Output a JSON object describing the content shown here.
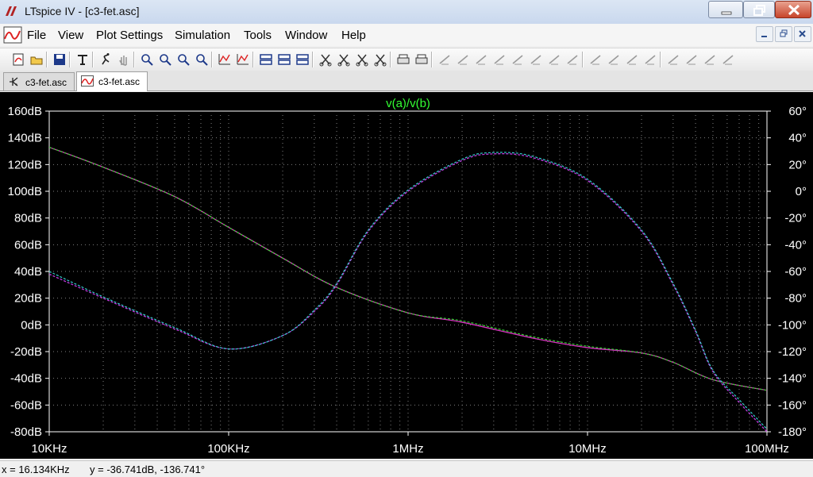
{
  "window": {
    "title": "LTspice IV - [c3-fet.asc]"
  },
  "menu": {
    "items": [
      "File",
      "View",
      "Plot Settings",
      "Simulation",
      "Tools",
      "Window",
      "Help"
    ]
  },
  "toolbar": {
    "icons": [
      "new-schematic-icon",
      "open-icon",
      "save-icon",
      "control-panel-icon",
      "run-icon",
      "halt-icon",
      "zoom-in-icon",
      "zoom-area-icon",
      "zoom-out-icon",
      "zoom-cancel-icon",
      "autorange-icon",
      "autorange-y-icon",
      "tile-horizontal-icon",
      "cascade-icon",
      "tile-vertical-icon",
      "cut-icon",
      "copy-icon",
      "paste-icon",
      "find-icon",
      "print-setup-icon",
      "print-icon",
      "wire-icon",
      "ground-icon",
      "label-icon",
      "resistor-icon",
      "capacitor-icon",
      "inductor-icon",
      "diode-icon",
      "component-icon",
      "move-icon",
      "drag-icon",
      "undo-icon",
      "redo-icon",
      "rotate-icon",
      "mirror-icon",
      "text-icon",
      "spice-directive-icon"
    ]
  },
  "tabs": [
    {
      "label": "c3-fet.asc",
      "icon": "schematic-icon",
      "active": false
    },
    {
      "label": "c3-fet.asc",
      "icon": "waveform-icon",
      "active": true
    }
  ],
  "status": {
    "x_readout": "x = 16.134KHz",
    "y_readout": "y = -36.741dB, -136.741°"
  },
  "colors": {
    "background": "#000000",
    "grid": "#7f7f7f",
    "trace_title": "#33ff33"
  },
  "chart_data": {
    "type": "line",
    "title": "v(a)/v(b)",
    "xscale": "log",
    "xlim": [
      10000,
      100000000
    ],
    "x_ticks": [
      {
        "value": 10000,
        "label": "10KHz"
      },
      {
        "value": 100000,
        "label": "100KHz"
      },
      {
        "value": 1000000,
        "label": "1MHz"
      },
      {
        "value": 10000000,
        "label": "10MHz"
      },
      {
        "value": 100000000,
        "label": "100MHz"
      }
    ],
    "ylim_left": [
      -80,
      160
    ],
    "y_ticks_left": [
      "160dB",
      "140dB",
      "120dB",
      "100dB",
      "80dB",
      "60dB",
      "40dB",
      "20dB",
      "0dB",
      "-20dB",
      "-40dB",
      "-60dB",
      "-80dB"
    ],
    "ylim_right": [
      -180,
      60
    ],
    "y_ticks_right": [
      "60°",
      "40°",
      "20°",
      "0°",
      "-20°",
      "-40°",
      "-60°",
      "-80°",
      "-100°",
      "-120°",
      "-140°",
      "-160°",
      "-180°"
    ],
    "grid": true,
    "series": [
      {
        "axis": "left",
        "color": "#ff3333",
        "points": [
          [
            10000,
            133
          ],
          [
            20000,
            118
          ],
          [
            50000,
            96
          ],
          [
            100000,
            73
          ],
          [
            200000,
            50
          ],
          [
            400000,
            28
          ],
          [
            1000000,
            9
          ],
          [
            2000000,
            2
          ],
          [
            5000000,
            -10
          ],
          [
            10000000,
            -17
          ],
          [
            20000000,
            -21
          ],
          [
            30000000,
            -28
          ],
          [
            50000000,
            -41
          ],
          [
            100000000,
            -49
          ]
        ]
      },
      {
        "axis": "left",
        "color": "#cc33cc",
        "points": [
          [
            10000,
            133
          ],
          [
            20000,
            118
          ],
          [
            50000,
            96
          ],
          [
            100000,
            73
          ],
          [
            200000,
            50
          ],
          [
            400000,
            28
          ],
          [
            1000000,
            9
          ],
          [
            2000000,
            2
          ],
          [
            5000000,
            -10
          ],
          [
            10000000,
            -17
          ],
          [
            20000000,
            -21
          ],
          [
            30000000,
            -28
          ],
          [
            50000000,
            -41
          ],
          [
            100000000,
            -49
          ]
        ]
      },
      {
        "axis": "left",
        "color": "#33cc33",
        "dashed": true,
        "points": [
          [
            10000,
            133
          ],
          [
            20000,
            118
          ],
          [
            50000,
            96
          ],
          [
            100000,
            73
          ],
          [
            200000,
            50
          ],
          [
            400000,
            28
          ],
          [
            1000000,
            9
          ],
          [
            2000000,
            3
          ],
          [
            5000000,
            -9
          ],
          [
            10000000,
            -16
          ],
          [
            20000000,
            -21
          ],
          [
            30000000,
            -28
          ],
          [
            50000000,
            -41
          ],
          [
            100000000,
            -49
          ]
        ]
      },
      {
        "axis": "right",
        "color": "#2255ff",
        "dashed": true,
        "points": [
          [
            10000,
            -62
          ],
          [
            20000,
            -80
          ],
          [
            50000,
            -103
          ],
          [
            100000,
            -118
          ],
          [
            200000,
            -108
          ],
          [
            300000,
            -90
          ],
          [
            400000,
            -70
          ],
          [
            600000,
            -30
          ],
          [
            1000000,
            0
          ],
          [
            2000000,
            23
          ],
          [
            3000000,
            28
          ],
          [
            5000000,
            25
          ],
          [
            10000000,
            8
          ],
          [
            20000000,
            -30
          ],
          [
            30000000,
            -70
          ],
          [
            40000000,
            -105
          ],
          [
            50000000,
            -135
          ],
          [
            70000000,
            -158
          ],
          [
            100000000,
            -180
          ]
        ]
      },
      {
        "axis": "right",
        "color": "#cc33cc",
        "dashed": true,
        "points": [
          [
            10000,
            -62
          ],
          [
            20000,
            -80
          ],
          [
            50000,
            -103
          ],
          [
            100000,
            -118
          ],
          [
            200000,
            -108
          ],
          [
            300000,
            -90
          ],
          [
            400000,
            -70
          ],
          [
            600000,
            -30
          ],
          [
            1000000,
            0
          ],
          [
            2000000,
            23
          ],
          [
            3000000,
            28
          ],
          [
            5000000,
            25
          ],
          [
            10000000,
            8
          ],
          [
            20000000,
            -30
          ],
          [
            30000000,
            -70
          ],
          [
            40000000,
            -105
          ],
          [
            50000000,
            -135
          ],
          [
            70000000,
            -158
          ],
          [
            100000000,
            -180
          ]
        ]
      },
      {
        "axis": "right",
        "color": "#33cccc",
        "dashed": true,
        "points": [
          [
            10000,
            -60
          ],
          [
            20000,
            -79
          ],
          [
            50000,
            -102
          ],
          [
            100000,
            -118
          ],
          [
            200000,
            -108
          ],
          [
            300000,
            -89
          ],
          [
            400000,
            -69
          ],
          [
            600000,
            -29
          ],
          [
            1000000,
            1
          ],
          [
            2000000,
            24
          ],
          [
            3000000,
            29
          ],
          [
            5000000,
            26
          ],
          [
            10000000,
            9
          ],
          [
            20000000,
            -29
          ],
          [
            30000000,
            -69
          ],
          [
            40000000,
            -104
          ],
          [
            50000000,
            -134
          ],
          [
            70000000,
            -156
          ],
          [
            100000000,
            -178
          ]
        ]
      }
    ]
  }
}
